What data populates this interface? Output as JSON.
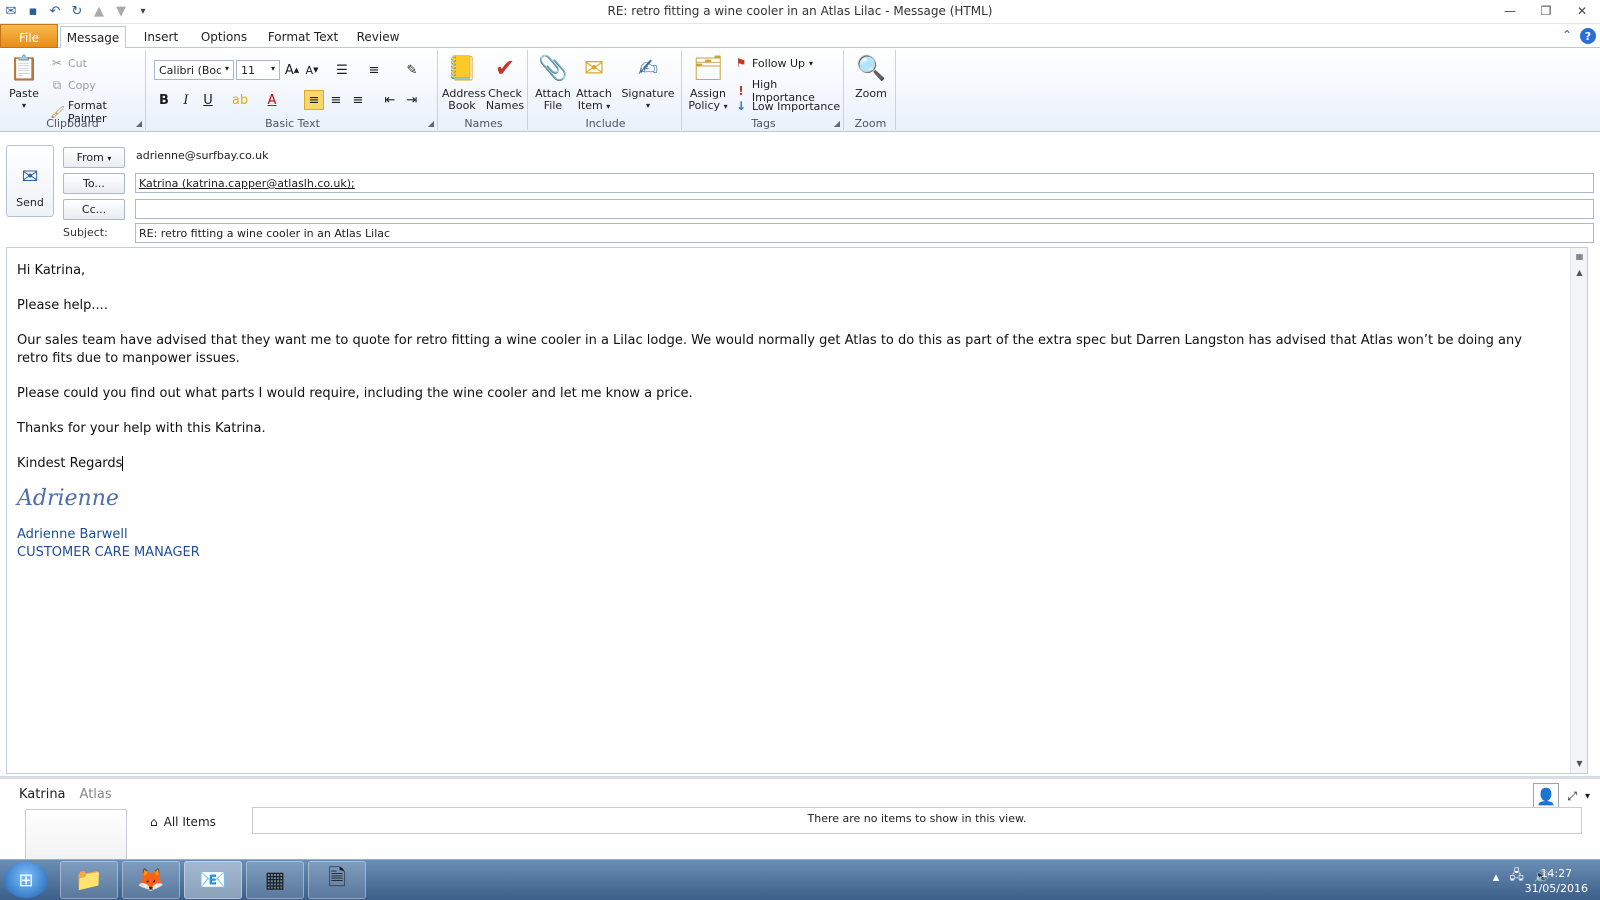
{
  "window": {
    "title": "RE: retro fitting a wine cooler in an Atlas Lilac  -  Message (HTML)"
  },
  "tabs": [
    "File",
    "Message",
    "Insert",
    "Options",
    "Format Text",
    "Review"
  ],
  "ribbon": {
    "clipboard": {
      "label": "Clipboard",
      "paste": "Paste",
      "cut": "Cut",
      "copy": "Copy",
      "format_painter": "Format Painter"
    },
    "basic_text": {
      "label": "Basic Text",
      "font": "Calibri (Body)",
      "size": "11",
      "bold": "B",
      "italic": "I",
      "underline": "U"
    },
    "names": {
      "label": "Names",
      "address_book": [
        "Address",
        "Book"
      ],
      "check_names": [
        "Check",
        "Names"
      ]
    },
    "include": {
      "label": "Include",
      "attach_file": [
        "Attach",
        "File"
      ],
      "attach_item": [
        "Attach",
        "Item"
      ],
      "signature": "Signature"
    },
    "tags": {
      "label": "Tags",
      "assign_policy": [
        "Assign",
        "Policy"
      ],
      "follow_up": "Follow Up",
      "high_importance": "High Importance",
      "low_importance": "Low Importance"
    },
    "zoom": {
      "label": "Zoom",
      "zoom": "Zoom"
    }
  },
  "header": {
    "send": "Send",
    "from_label": "From",
    "from_value": "adrienne@surfbay.co.uk",
    "to_label": "To...",
    "to_value": "Katrina (katrina.capper@atlaslh.co.uk);",
    "cc_label": "Cc...",
    "cc_value": "",
    "subject_label": "Subject:",
    "subject_value": "RE: retro fitting a wine cooler in an Atlas Lilac"
  },
  "body": {
    "greeting": "Hi Katrina,",
    "p1": "Please help....",
    "p2": "Our sales team have advised that they want me to quote for retro fitting a wine cooler in a Lilac lodge.  We would normally get Atlas to do this as part of the extra spec but Darren Langston has advised that Atlas won’t be doing any retro fits due to manpower issues.",
    "p3": "Please could you find out what parts I would require, including the wine cooler and let me know a price.",
    "p4": "Thanks for your help with this Katrina.",
    "closing": "Kindest Regards",
    "signature_script": "Adrienne",
    "sig_name": "Adrienne Barwell",
    "sig_title": "CUSTOMER CARE MANAGER"
  },
  "people_pane": {
    "name": "Katrina",
    "company": "Atlas",
    "all_items": "All Items",
    "empty_message": "There are no items to show in this view."
  },
  "taskbar": {
    "time": "14:27",
    "date": "31/05/2016"
  },
  "colors": {
    "file_tab": "#e88d15",
    "signature_blue": "#1f4e98",
    "taskbar": "#3c5f8a"
  }
}
